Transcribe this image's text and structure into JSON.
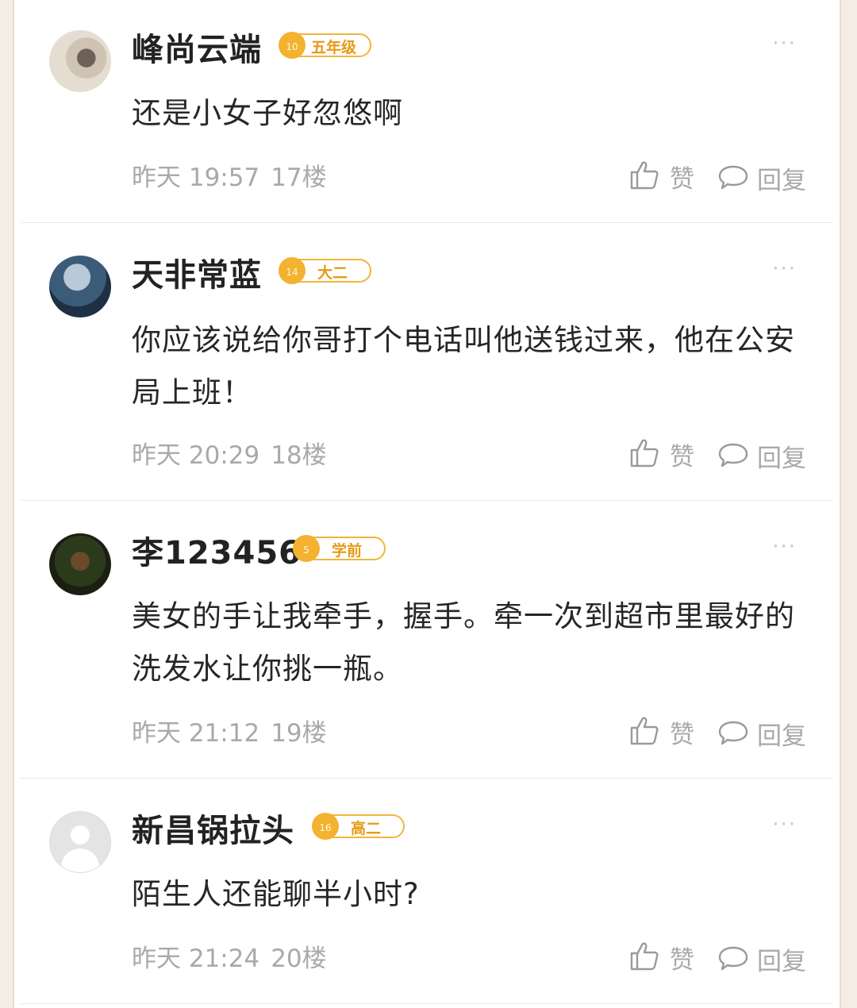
{
  "comments": [
    {
      "username": "峰尚云端",
      "level_num": "10",
      "level": "五年级",
      "text": "还是小女子好忽悠啊",
      "date": "昨天 19:57",
      "floor": "17楼",
      "like_label": "赞",
      "reply_label": "回复",
      "more_label": "···"
    },
    {
      "username": "天非常蓝",
      "level_num": "14",
      "level": "大二",
      "text": "你应该说给你哥打个电话叫他送钱过来，他在公安局上班！",
      "date": "昨天 20:29",
      "floor": "18楼",
      "like_label": "赞",
      "reply_label": "回复",
      "more_label": "···"
    },
    {
      "username": "李123456",
      "level_num": "5",
      "level": "学前",
      "text": "美女的手让我牵手，握手。牵一次到超市里最好的洗发水让你挑一瓶。",
      "date": "昨天 21:12",
      "floor": "19楼",
      "like_label": "赞",
      "reply_label": "回复",
      "more_label": "···"
    },
    {
      "username": "新昌锅拉头",
      "level_num": "16",
      "level": "高二",
      "text": "陌生人还能聊半小时?",
      "date": "昨天 21:24",
      "floor": "20楼",
      "like_label": "赞",
      "reply_label": "回复",
      "more_label": "···"
    }
  ],
  "colors": {
    "badge": "#f1b53a",
    "meta_text": "#a9a9a9",
    "name_text": "#222222"
  }
}
